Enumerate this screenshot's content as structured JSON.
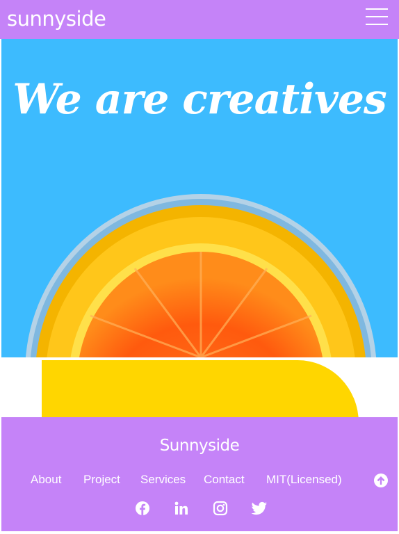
{
  "header": {
    "brand": "sunnyside",
    "menu_icon": "hamburger-menu-icon",
    "background": "#c583f8"
  },
  "hero": {
    "title": "We are creatives",
    "background": "#3dbbfe",
    "image": "orange-slice-in-glass"
  },
  "feature_shape": {
    "color": "#ffd600"
  },
  "footer": {
    "title": "Sunnyside",
    "background": "#c583f8",
    "links": [
      {
        "label": "About"
      },
      {
        "label": "Project"
      },
      {
        "label": "Services"
      },
      {
        "label": "Contact"
      },
      {
        "label": "MIT(Licensed)"
      }
    ],
    "scroll_top_icon": "arrow-up-circle-icon",
    "socials": [
      {
        "icon": "facebook-icon"
      },
      {
        "icon": "linkedin-icon"
      },
      {
        "icon": "instagram-icon"
      },
      {
        "icon": "twitter-icon"
      }
    ]
  }
}
